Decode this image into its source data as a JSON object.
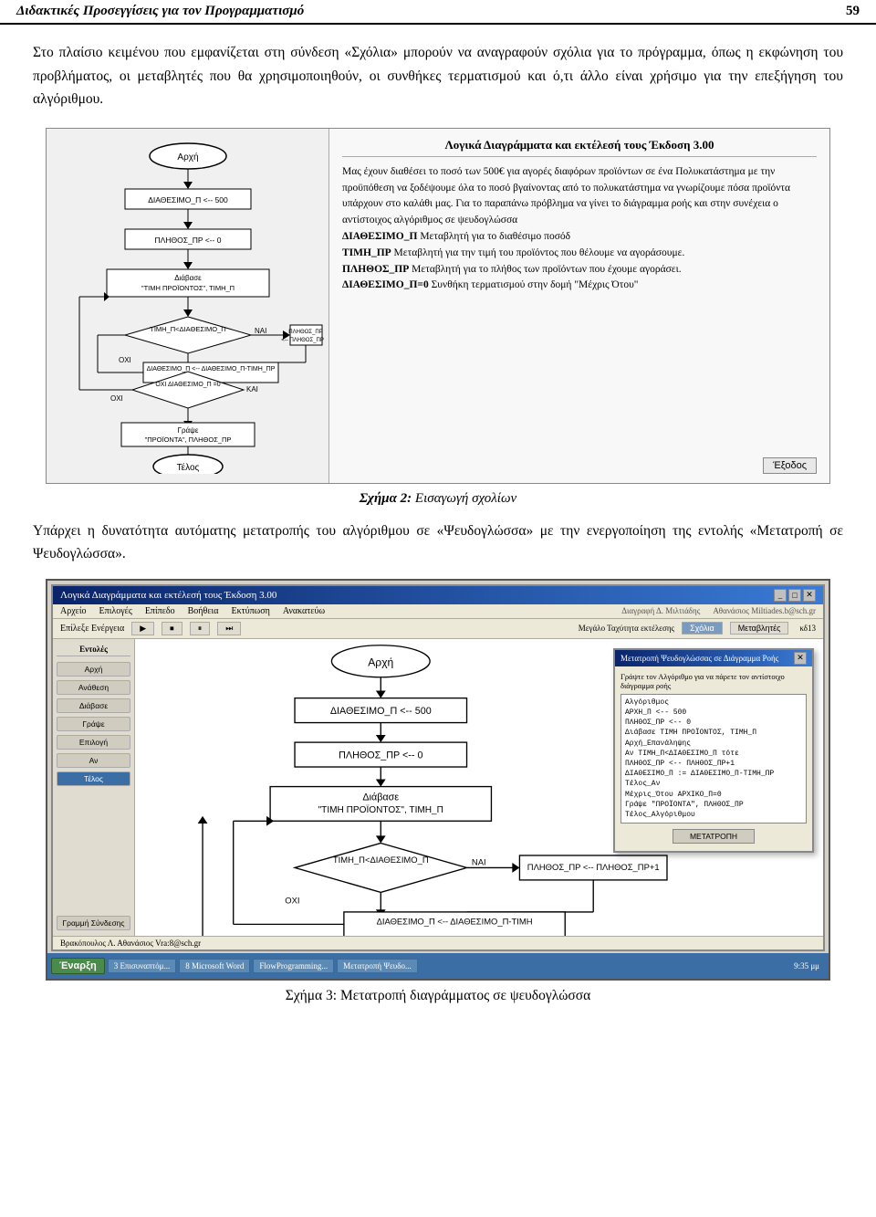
{
  "header": {
    "left": "Διδακτικές Προσεγγίσεις για τον Προγραμματισμό",
    "right": "59"
  },
  "intro": {
    "text": "Στο πλαίσιο κειμένου που εμφανίζεται στη σύνδεση «Σχόλια» μπορούν να αναγραφούν σχόλια για το πρόγραμμα, όπως η εκφώνηση του προβλήματος, οι μεταβλητές που θα χρησιμοποιηθούν, οι συνθήκες τερματισμού και ό,τι άλλο είναι χρήσιμο για την επεξήγηση του αλγόριθμου."
  },
  "figure1": {
    "left_flowchart": "flowchart",
    "right_title": "Λογικά Διαγράμματα και εκτέλεσή τους Έκδοση 3.00",
    "right_text": "Μας έχουν διαθέσει το ποσό των 500€ για αγορές διαφόρων προϊόντων σε ένα Πολυκατάστημα με την προϋπόθεση να ξοδέψουμε όλα το ποσό βγαίνοντας από το πολυκατάστημα να γνωρίζουμε πόσα προϊόντα υπάρχουν στο καλάθι μας. Για το παραπάνω πρόβλημα να γίνει το διάγραμμα ροής και στην συνέχεια ο αντίστοιχος αλγόριθμος σε ψευδογλώσσα\nΔΙΑΘΕΣΙΜΟ_Π Μεταβλητή για το διαθέσιμο ποσόδ\nΤΙΜΗ_ΠΡ Μεταβλητή για την τιμή του προϊόντος που θέλουμε να αγοράσουμε.\nΠΛΗΘΟΣ_ΠΡ Μεταβλητή για το πλήθος των προϊόντων που έχουμε αγοράσει.\nΔΙΑΘΕΣΙΜΟ_Π=0 Συνθήκη τερματισμού στην δομή \"Μέχρις Ότου\"",
    "exit_button": "Έξοδος"
  },
  "caption1": {
    "label": "Σχήμα 2:",
    "text": " Εισαγωγή σχολίων"
  },
  "body_text": {
    "text": "Υπάρχει η δυνατότητα αυτόματης μετατροπής του αλγόριθμου σε «Ψευδογλώσσα» με την ενεργοποίηση της εντολής «Μετατροπή σε Ψευδογλώσσα»."
  },
  "figure2": {
    "app_title": "Λογικά Διαγράμματα και εκτέλεσή τους Έκδοση 3.00",
    "menu_items": [
      "Αρχείο",
      "Επιλογές",
      "Επίπεδο",
      "Βοήθεια",
      "Εκτύπωση",
      "Ανακατεύω",
      "Διαγραφή Δ. Μιλτιάδης",
      "Αθανάσιος Miltiades.b@sch.gr"
    ],
    "toolbar_label": "Επίλεξε Ενέργεια",
    "toolbar_buttons": [
      "▶",
      "⏹",
      "⏸",
      "⏭"
    ],
    "scholeia_btn": "Σχόλια",
    "metavlites_btn": "Μεταβλητές",
    "sidebar_label": "Εντολές",
    "sidebar_items": [
      "Αρχή",
      "Ανάθεση",
      "Διάβασε",
      "Γράψε",
      "Επιλογή",
      "Αν",
      "Τέλος",
      "Γραμμή Σύνδεσης"
    ],
    "dialog_title": "Μετατροπή Ψευδογλώσσας σε Διάγραμμα Ροής",
    "dialog_instruction": "Γράψτε τον Αλγόριθμο για να πάρετε τον αντίστοιχο διάγραμμα ροής",
    "dialog_content": "Αλγόριθμος\nΑΡΧΗ_Π <-- 500\nΠΛΗΘΟΣ_ΠΡ <-- 0\nΔιάβασε ΤΙΜΗ ΠΡΟΪΟΝΤΟΣ, ΤΙΜΗ_Π\nΑρχή_Επανάληψης\nΑν ΤΙΜΗ_Π<ΔΙΑΘΕΣΙΜΟ_Π τότε\nΠΛΗΘΟΣ_ΠΡ <-- ΠΛΗΘΟΣ_ΠΡ+1\nΔΙΑΘΕΣΙΜΟ_Π := ΔΙΑΘΕΣΙΜΟ_Π-ΤΙΜΗ_ΠΡ\nΤέλος_Αν\nΜέχρις_Ότου ΑΡΧΙΚΟ_Π=0\nΓράψε \"ΠΡΟΪΟΝΤΑ\", ΠΛΗΘΟΣ_ΠΡ\nΤέλος_Αλγόριθμου",
    "dialog_btn": "ΜΕΤΑΤΡΟΠΗ",
    "statusbar_text": "Βρακόπουλος Λ. Αθανάσιος Vra:8@sch.gr",
    "taskbar_start": "Έναρξη",
    "taskbar_items": [
      "3 Επισυναπτόμ...",
      "8 Microsoft Word",
      "FlowProgramming...",
      "Μετατροπή Ψευδο..."
    ],
    "taskbar_time": "9:35 μμ"
  },
  "caption2": {
    "label": "Σχήμα 3:",
    "text": " Μετατροπή διαγράμματος σε ψευδογλώσσα"
  }
}
